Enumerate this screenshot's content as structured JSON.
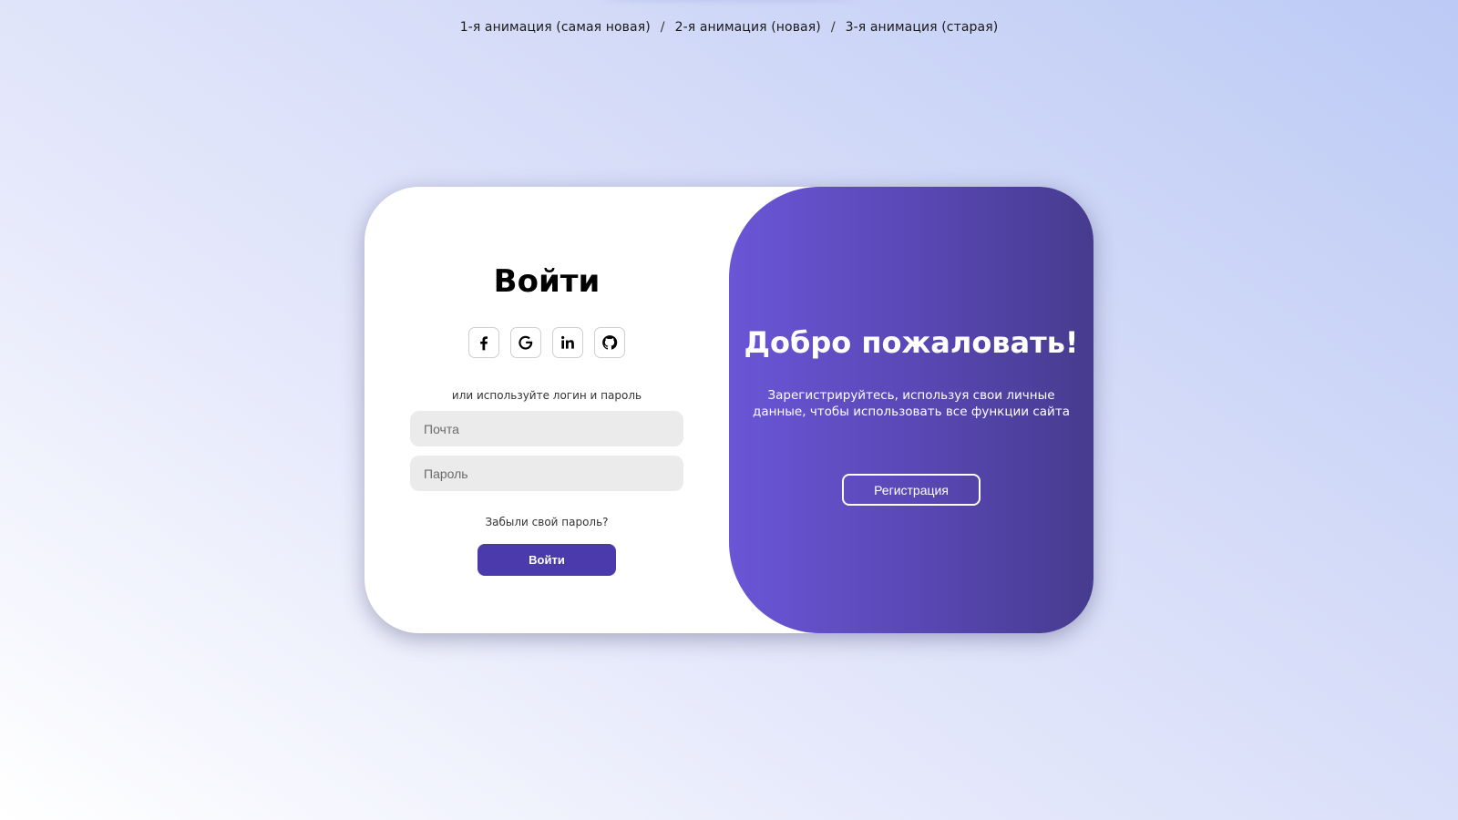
{
  "nav": {
    "links": [
      {
        "label": "1-я анимация (самая новая)"
      },
      {
        "label": "2-я анимация (новая)"
      },
      {
        "label": "3-я анимация (старая)"
      }
    ],
    "separator": "/"
  },
  "signin": {
    "title": "Войти",
    "socials": [
      {
        "icon": "facebook-icon"
      },
      {
        "icon": "google-icon"
      },
      {
        "icon": "linkedin-icon"
      },
      {
        "icon": "github-icon"
      }
    ],
    "hint": "или используйте логин и пароль",
    "email_placeholder": "Почта",
    "password_placeholder": "Пароль",
    "forgot": "Забыли свой пароль?",
    "submit": "Войти"
  },
  "panel": {
    "title": "Добро пожаловать!",
    "text": "Зарегистрируйтесь, используя свои личные данные, чтобы использовать все функции сайта",
    "button": "Регистрация"
  },
  "colors": {
    "accent": "#4b3aab",
    "panel_gradient_start": "#6a56d6",
    "panel_gradient_end": "#463b8e"
  }
}
